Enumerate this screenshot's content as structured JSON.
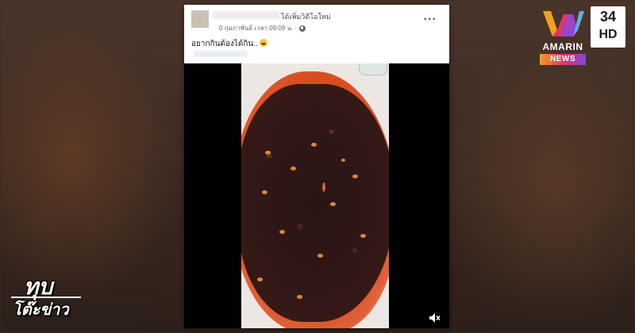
{
  "post": {
    "action_text": "ได้เพิ่มวิดีโอใหม่",
    "meta_text": "0 กุมภาพันธ์ เวลา 09:09 น. ·",
    "caption": "อยากกินต้องได้กิน..",
    "more_icon": "more-horizontal-icon",
    "privacy_icon": "globe-icon",
    "caption_emoji": "grinning-face-emoji"
  },
  "video": {
    "mute_icon": "speaker-muted-icon"
  },
  "broadcast": {
    "logo_text": "AMARIN",
    "news_label": "NEWS",
    "channel_number": "34",
    "channel_hd": "HD",
    "show_line1": "ทุบ",
    "show_line2": "โต๊ะข่าว"
  },
  "colors": {
    "card_background": "#ffffff",
    "video_letterbox": "#000000",
    "chili_oil": "#d94d1f",
    "logo_gradient": [
      "#f2a11b",
      "#e3336c",
      "#7d4bd8"
    ]
  }
}
